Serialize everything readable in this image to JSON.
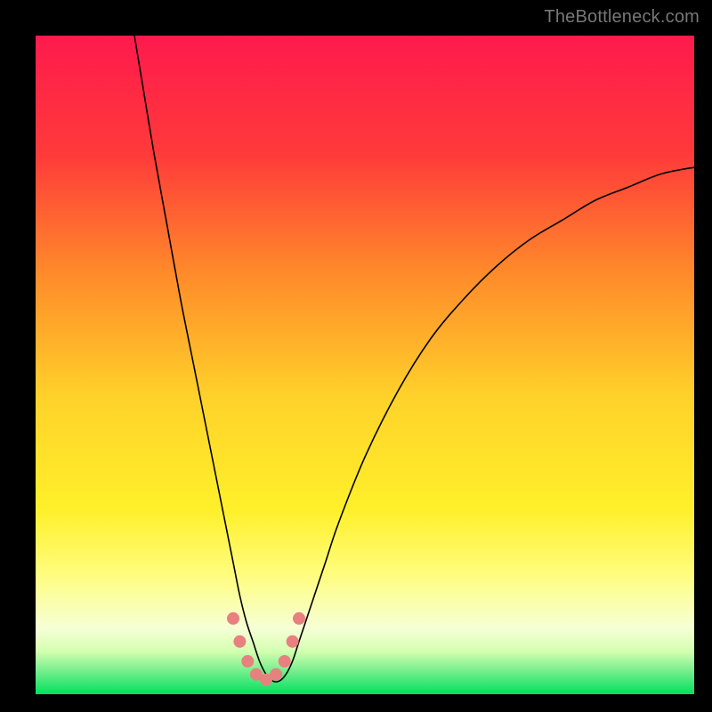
{
  "watermark": "TheBottleneck.com",
  "chart_data": {
    "type": "line",
    "title": "",
    "xlabel": "",
    "ylabel": "",
    "x_range": [
      0,
      100
    ],
    "y_range": [
      0,
      100
    ],
    "background": {
      "description": "Vertical gradient from red (top) through orange, yellow, pale yellow, to green (bottom)",
      "stops": [
        {
          "offset": 0.0,
          "color": "#ff1a4d"
        },
        {
          "offset": 0.18,
          "color": "#ff3a3a"
        },
        {
          "offset": 0.36,
          "color": "#ff8a2a"
        },
        {
          "offset": 0.55,
          "color": "#ffd22a"
        },
        {
          "offset": 0.72,
          "color": "#fff02a"
        },
        {
          "offset": 0.82,
          "color": "#fffd80"
        },
        {
          "offset": 0.9,
          "color": "#f6ffd6"
        },
        {
          "offset": 0.935,
          "color": "#d4ffb0"
        },
        {
          "offset": 0.962,
          "color": "#7ef090"
        },
        {
          "offset": 1.0,
          "color": "#00e060"
        }
      ]
    },
    "series": [
      {
        "name": "bottleneck-curve",
        "color": "#000000",
        "stroke_width": 1.6,
        "x": [
          15,
          16,
          18,
          20,
          22,
          24,
          26,
          28,
          30,
          31,
          32,
          33,
          34,
          35,
          36,
          37,
          38,
          39,
          40,
          42,
          44,
          46,
          50,
          55,
          60,
          65,
          70,
          75,
          80,
          85,
          90,
          95,
          100
        ],
        "y": [
          100,
          94,
          82,
          71,
          60,
          50,
          40,
          30,
          20,
          15,
          11,
          8,
          5,
          3,
          2,
          2,
          3,
          5,
          8,
          14,
          20,
          26,
          36,
          46,
          54,
          60,
          65,
          69,
          72,
          75,
          77,
          79,
          80
        ]
      }
    ],
    "markers": {
      "name": "endpoint-dots",
      "color": "#e88080",
      "radius": 7,
      "x": [
        30.0,
        31.0,
        32.2,
        33.5,
        35.0,
        36.5,
        37.8,
        39.0,
        40.0
      ],
      "y": [
        11.5,
        8.0,
        5.0,
        3.0,
        2.2,
        3.0,
        5.0,
        8.0,
        11.5
      ]
    }
  }
}
